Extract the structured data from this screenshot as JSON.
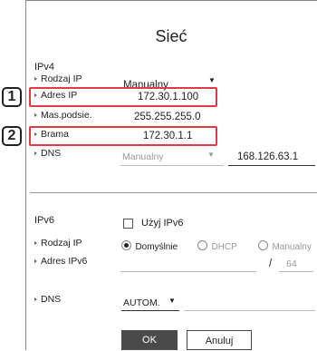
{
  "title": "Sieć",
  "ipv4": {
    "section_label": "IPv4",
    "mode_label": "Rodzaj IP",
    "mode_value": "Manualny",
    "ip_label": "Adres IP",
    "ip_value": "172.30.1.100",
    "mask_label": "Mas.podsie.",
    "mask_value": "255.255.255.0",
    "gateway_label": "Brama",
    "gateway_value": "172.30.1.1",
    "dns_label": "DNS",
    "dns_mode": "Manualny",
    "dns_value": "168.126.63.1"
  },
  "badges": [
    "1",
    "2"
  ],
  "ipv6": {
    "section_label": "IPv6",
    "use_label": "Użyj IPv6",
    "mode_label": "Rodzaj IP",
    "opt_default": "Domyślnie",
    "opt_dhcp": "DHCP",
    "opt_manual": "Manualny",
    "addr_label": "Adres IPv6",
    "prefix_sep": "/",
    "prefix_value": "64",
    "dns_label": "DNS",
    "dns_mode": "AUTOM."
  },
  "buttons": {
    "ok": "OK",
    "cancel": "Anuluj"
  }
}
